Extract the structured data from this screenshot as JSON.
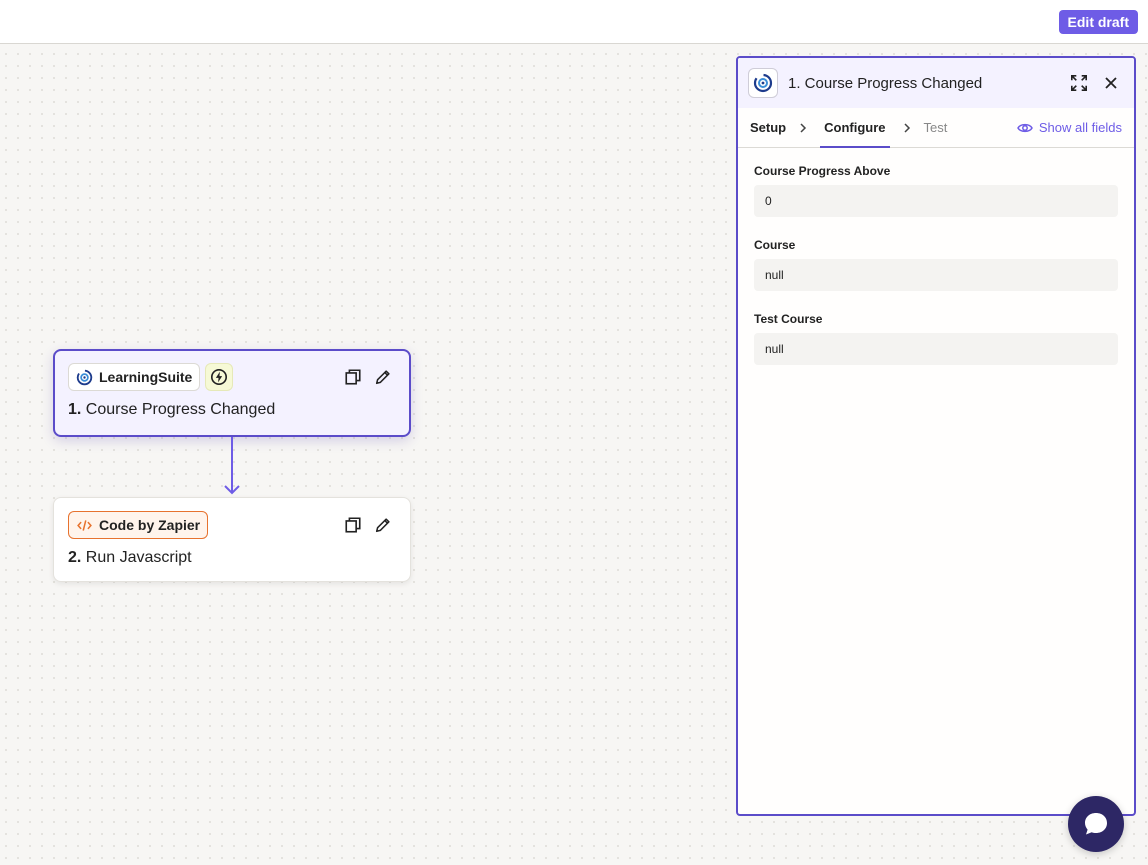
{
  "topbar": {
    "edit_draft_label": "Edit draft"
  },
  "canvas": {
    "steps": [
      {
        "app_name": "LearningSuite",
        "number": "1.",
        "title": "Course Progress Changed",
        "selected": true,
        "icon": "learningsuite-logo-icon",
        "trigger": "lightning-bolt-icon"
      },
      {
        "app_name": "Code by Zapier",
        "number": "2.",
        "title": "Run Javascript",
        "selected": false,
        "icon": "code-icon"
      }
    ]
  },
  "panel": {
    "title": "1. Course Progress Changed",
    "tabs": [
      {
        "label": "Setup",
        "state": "complete"
      },
      {
        "label": "Configure",
        "state": "active"
      },
      {
        "label": "Test",
        "state": "inactive"
      }
    ],
    "show_all_fields_label": "Show all fields",
    "fields": [
      {
        "label": "Course Progress Above",
        "value": "0"
      },
      {
        "label": "Course",
        "value": "null"
      },
      {
        "label": "Test Course",
        "value": "null"
      }
    ]
  },
  "colors": {
    "accent": "#6e5ce6",
    "selected_border": "#5b4cc9",
    "code_orange": "#e7722e",
    "chat_bg": "#2d2765"
  }
}
